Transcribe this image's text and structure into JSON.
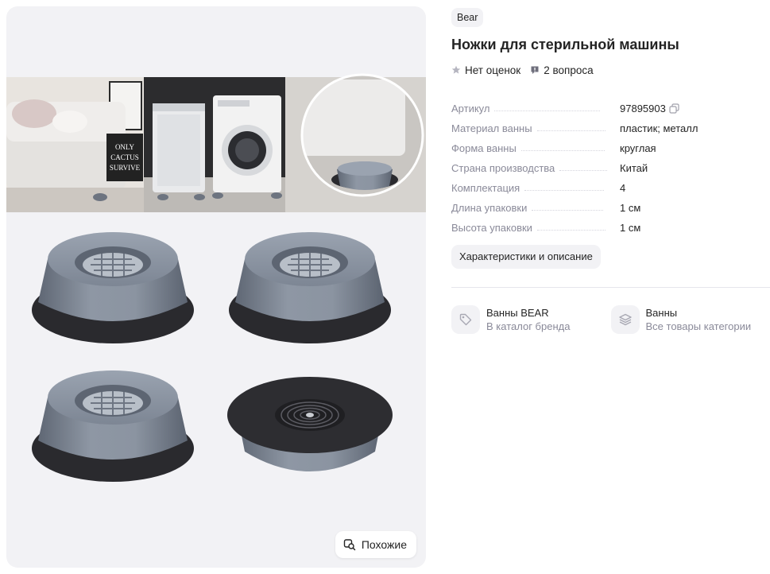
{
  "product": {
    "brand": "Bear",
    "title": "Ножки для стерильной машины",
    "rating_text": "Нет оценок",
    "questions_text": "2 вопроса"
  },
  "gallery": {
    "similar_label": "Похожие",
    "photo_lettering": [
      "CACTUS",
      "SURVIVE",
      "ONLY"
    ]
  },
  "specs": [
    {
      "label": "Артикул",
      "value": "97895903"
    },
    {
      "label": "Материал ванны",
      "value": "пластик; металл"
    },
    {
      "label": "Форма ванны",
      "value": "круглая"
    },
    {
      "label": "Страна производства",
      "value": "Китай"
    },
    {
      "label": "Комплектация",
      "value": "4"
    },
    {
      "label": "Длина упаковки",
      "value": "1 см"
    },
    {
      "label": "Высота упаковки",
      "value": "1 см"
    }
  ],
  "chars_button": "Характеристики и описание",
  "links": [
    {
      "title": "Ванны BEAR",
      "subtitle": "В каталог бренда",
      "icon": "tag-icon"
    },
    {
      "title": "Ванны",
      "subtitle": "Все товары категории",
      "icon": "layers-icon"
    }
  ],
  "colors": {
    "chip_bg": "#f2f2f5",
    "muted_text": "#8a8a99",
    "foot_gray": "#7d8694",
    "base_black": "#2a2a2e"
  }
}
